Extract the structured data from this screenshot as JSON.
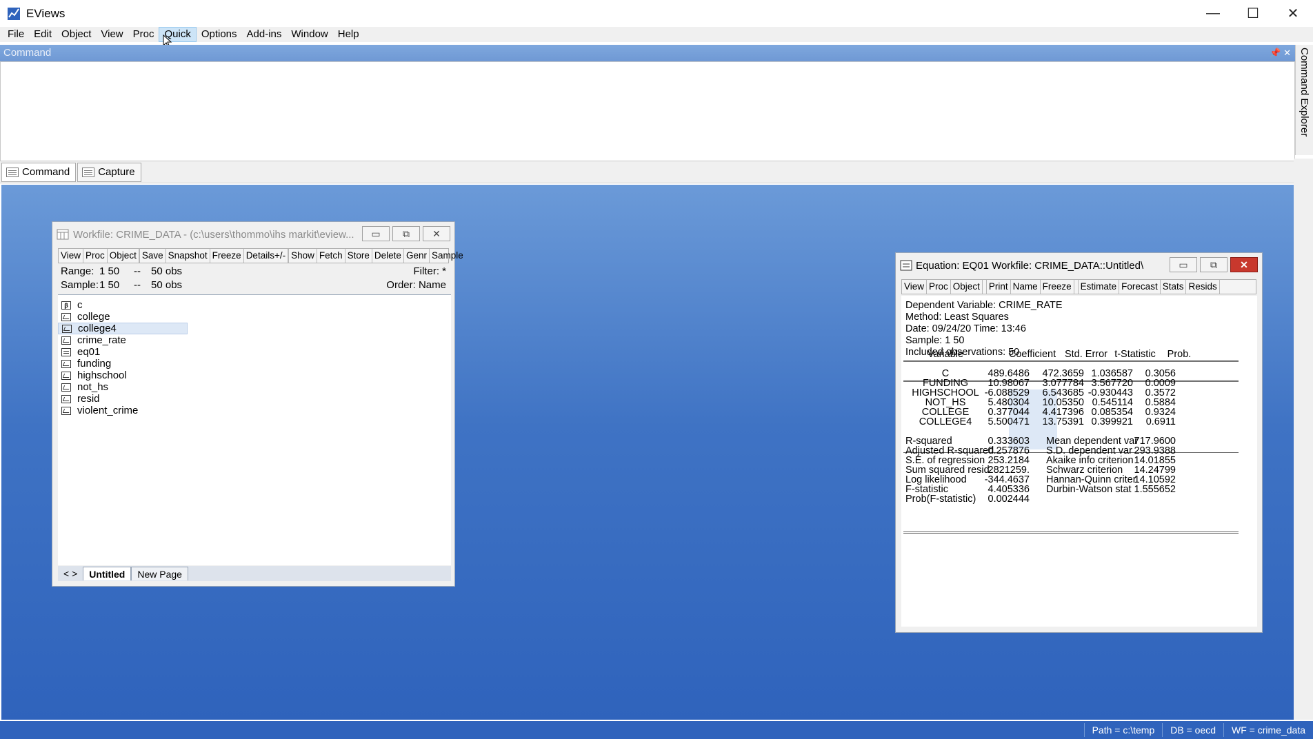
{
  "app": {
    "title": "EViews",
    "window_controls": {
      "minimize": "—",
      "maximize": "☐",
      "close": "✕"
    }
  },
  "menu": [
    "File",
    "Edit",
    "Object",
    "View",
    "Proc",
    "Quick",
    "Options",
    "Add-ins",
    "Window",
    "Help"
  ],
  "active_menu": "Quick",
  "command_pane": {
    "header": "Command",
    "header_controls": "📌 ✕",
    "explorer_label": "Command Explorer",
    "tabs": [
      "Command",
      "Capture"
    ]
  },
  "workfile_window": {
    "title": "Workfile: CRIME_DATA - (c:\\users\\thommo\\ihs markit\\eview...",
    "toolbar": [
      "View",
      "Proc",
      "Object",
      "|",
      "Save",
      "Snapshot",
      "Freeze",
      "Details+/-",
      "|",
      "Show",
      "Fetch",
      "Store",
      "Delete",
      "Genr",
      "Sample"
    ],
    "range_label": "Range:",
    "range_value": "1 50",
    "range_sep": "--",
    "range_obs": "50 obs",
    "sample_label": "Sample:",
    "sample_value": "1 50",
    "sample_sep": "--",
    "sample_obs": "50 obs",
    "filter": "Filter: *",
    "order": "Order: Name",
    "objects": [
      {
        "name": "c",
        "type": "coef"
      },
      {
        "name": "college",
        "type": "series"
      },
      {
        "name": "college4",
        "type": "series",
        "selected": true
      },
      {
        "name": "crime_rate",
        "type": "series"
      },
      {
        "name": "eq01",
        "type": "equation"
      },
      {
        "name": "funding",
        "type": "series"
      },
      {
        "name": "highschool",
        "type": "series"
      },
      {
        "name": "not_hs",
        "type": "series"
      },
      {
        "name": "resid",
        "type": "series"
      },
      {
        "name": "violent_crime",
        "type": "series"
      }
    ],
    "page_nav": "< >",
    "page_tabs": [
      "Untitled",
      "New Page"
    ]
  },
  "equation_window": {
    "title": "Equation: EQ01   Workfile: CRIME_DATA::Untitled\\",
    "toolbar": [
      "View",
      "Proc",
      "Object",
      "|",
      "Print",
      "Name",
      "Freeze",
      "|",
      "Estimate",
      "Forecast",
      "Stats",
      "Resids"
    ],
    "header_lines": [
      "Dependent Variable: CRIME_RATE",
      "Method: Least Squares",
      "Date: 09/24/20   Time: 13:46",
      "Sample: 1 50",
      "Included observations: 50"
    ],
    "columns": [
      "Variable",
      "Coefficient",
      "Std. Error",
      "t-Statistic",
      "Prob."
    ],
    "rows": [
      [
        "C",
        "489.6486",
        "472.3659",
        "1.036587",
        "0.3056"
      ],
      [
        "FUNDING",
        "10.98067",
        "3.077784",
        "3.567720",
        "0.0009"
      ],
      [
        "HIGHSCHOOL",
        "-6.088529",
        "6.543685",
        "-0.930443",
        "0.3572"
      ],
      [
        "NOT_HS",
        "5.480304",
        "10.05350",
        "0.545114",
        "0.5884"
      ],
      [
        "COLLEGE",
        "0.377044",
        "4.417396",
        "0.085354",
        "0.9324"
      ],
      [
        "COLLEGE4",
        "5.500471",
        "13.75391",
        "0.399921",
        "0.6911"
      ]
    ],
    "stats": [
      [
        "R-squared",
        "0.333603",
        "Mean dependent var",
        "717.9600"
      ],
      [
        "Adjusted R-squared",
        "0.257876",
        "S.D. dependent var",
        "293.9388"
      ],
      [
        "S.E. of regression",
        "253.2184",
        "Akaike info criterion",
        "14.01855"
      ],
      [
        "Sum squared resid",
        "2821259.",
        "Schwarz criterion",
        "14.24799"
      ],
      [
        "Log likelihood",
        "-344.4637",
        "Hannan-Quinn criter.",
        "14.10592"
      ],
      [
        "F-statistic",
        "4.405336",
        "Durbin-Watson stat",
        "1.555652"
      ],
      [
        "Prob(F-statistic)",
        "0.002444",
        "",
        ""
      ]
    ]
  },
  "status_bar": [
    "Path = c:\\temp",
    "DB = oecd",
    "WF = crime_data"
  ],
  "colors": {
    "desktop": "#3f73c4",
    "accent": "#6f98d4",
    "selection": "#dde8f6",
    "close_red": "#c8382d"
  }
}
